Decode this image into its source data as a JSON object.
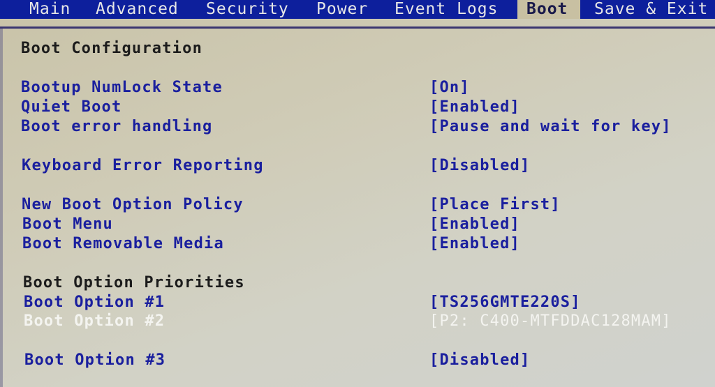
{
  "menu": {
    "tabs": [
      {
        "label": "Main"
      },
      {
        "label": "Advanced"
      },
      {
        "label": "Security"
      },
      {
        "label": "Power"
      },
      {
        "label": "Event Logs"
      },
      {
        "label": "Boot",
        "active": true
      },
      {
        "label": "Save & Exit"
      }
    ]
  },
  "section_title": "Boot Configuration",
  "settings": [
    {
      "label": "Bootup NumLock State",
      "value": "[On]"
    },
    {
      "label": "Quiet Boot",
      "value": "[Enabled]"
    },
    {
      "label": "Boot error handling",
      "value": "[Pause and wait for key]"
    },
    {
      "label": "Keyboard Error Reporting",
      "value": "[Disabled]"
    },
    {
      "label": "New Boot Option Policy",
      "value": "[Place First]"
    },
    {
      "label": "Boot Menu",
      "value": "[Enabled]"
    },
    {
      "label": "Boot Removable Media",
      "value": "[Enabled]"
    }
  ],
  "priorities_title": "Boot Option Priorities",
  "boot_options": [
    {
      "label": "Boot Option #1",
      "value": "[TS256GMTE220S]"
    },
    {
      "label": "Boot Option #2",
      "value": "[P2: C400-MTFDDAC128MAM]",
      "selected": true
    },
    {
      "label": "Boot Option #3",
      "value": "[Disabled]"
    }
  ],
  "colors": {
    "menubar": "#0d1f9c",
    "item_text": "#1a1f9e",
    "selected_text": "#f4f4f0",
    "background": "#cfcbb6"
  }
}
